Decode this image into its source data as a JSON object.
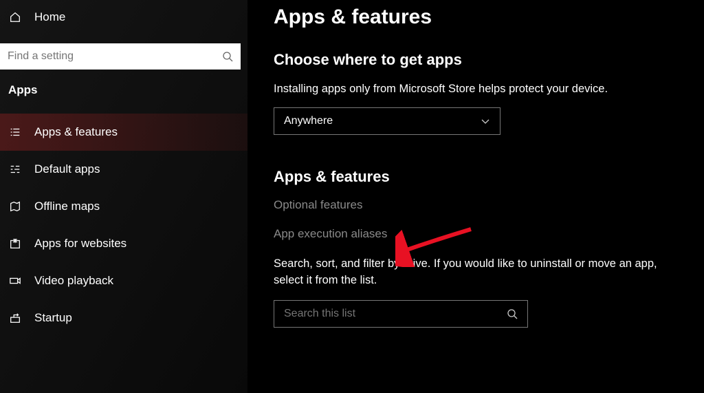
{
  "sidebar": {
    "home_label": "Home",
    "search_placeholder": "Find a setting",
    "section_label": "Apps",
    "items": [
      {
        "label": "Apps & features"
      },
      {
        "label": "Default apps"
      },
      {
        "label": "Offline maps"
      },
      {
        "label": "Apps for websites"
      },
      {
        "label": "Video playback"
      },
      {
        "label": "Startup"
      }
    ],
    "active_index": 0
  },
  "main": {
    "page_title": "Apps & features",
    "section1_heading": "Choose where to get apps",
    "section1_desc": "Installing apps only from Microsoft Store helps protect your device.",
    "source_select_value": "Anywhere",
    "section2_heading": "Apps & features",
    "link_optional_features": "Optional features",
    "link_app_execution_aliases": "App execution aliases",
    "filter_desc": "Search, sort, and filter by drive. If you would like to uninstall or move an app, select it from the list.",
    "list_search_placeholder": "Search this list"
  }
}
